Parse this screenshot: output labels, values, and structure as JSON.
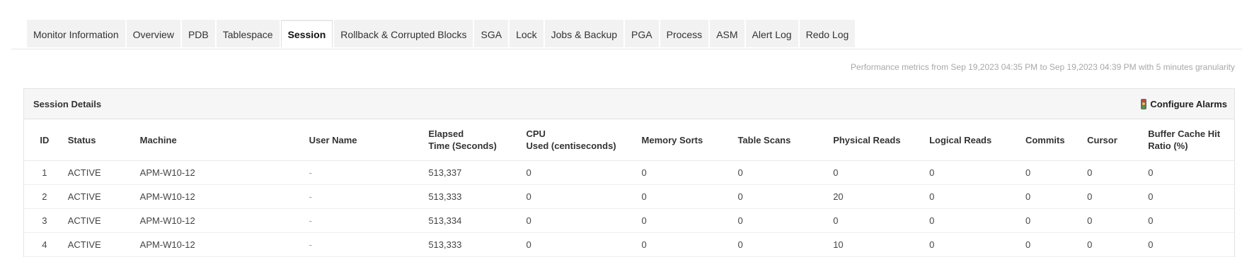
{
  "tabs": [
    {
      "label": "Monitor Information",
      "active": false
    },
    {
      "label": "Overview",
      "active": false
    },
    {
      "label": "PDB",
      "active": false
    },
    {
      "label": "Tablespace",
      "active": false
    },
    {
      "label": "Session",
      "active": true
    },
    {
      "label": "Rollback & Corrupted Blocks",
      "active": false
    },
    {
      "label": "SGA",
      "active": false
    },
    {
      "label": "Lock",
      "active": false
    },
    {
      "label": "Jobs & Backup",
      "active": false
    },
    {
      "label": "PGA",
      "active": false
    },
    {
      "label": "Process",
      "active": false
    },
    {
      "label": "ASM",
      "active": false
    },
    {
      "label": "Alert Log",
      "active": false
    },
    {
      "label": "Redo Log",
      "active": false
    }
  ],
  "performance_text": "Performance metrics from Sep 19,2023 04:35 PM to Sep 19,2023 04:39 PM with 5 minutes granularity",
  "panel": {
    "title": "Session Details",
    "configure_alarms": "Configure Alarms"
  },
  "colors": {
    "tab_bg": "#f2f2f2",
    "panel_head_bg": "#f6f6f6",
    "muted_text": "#a8a8a8"
  },
  "table": {
    "headers": [
      [
        "ID"
      ],
      [
        "Status"
      ],
      [
        "Machine"
      ],
      [
        "User Name"
      ],
      [
        "Elapsed",
        "Time (Seconds)"
      ],
      [
        "CPU",
        "Used (centiseconds)"
      ],
      [
        "Memory Sorts"
      ],
      [
        "Table Scans"
      ],
      [
        "Physical Reads"
      ],
      [
        "Logical Reads"
      ],
      [
        "Commits"
      ],
      [
        "Cursor"
      ],
      [
        "Buffer Cache Hit",
        "Ratio (%)"
      ]
    ],
    "rows": [
      [
        "1",
        "ACTIVE",
        "APM-W10-12",
        "-",
        "513,337",
        "0",
        "0",
        "0",
        "0",
        "0",
        "0",
        "0",
        "0"
      ],
      [
        "2",
        "ACTIVE",
        "APM-W10-12",
        "-",
        "513,333",
        "0",
        "0",
        "0",
        "20",
        "0",
        "0",
        "0",
        "0"
      ],
      [
        "3",
        "ACTIVE",
        "APM-W10-12",
        "-",
        "513,334",
        "0",
        "0",
        "0",
        "0",
        "0",
        "0",
        "0",
        "0"
      ],
      [
        "4",
        "ACTIVE",
        "APM-W10-12",
        "-",
        "513,333",
        "0",
        "0",
        "0",
        "10",
        "0",
        "0",
        "0",
        "0"
      ]
    ]
  }
}
